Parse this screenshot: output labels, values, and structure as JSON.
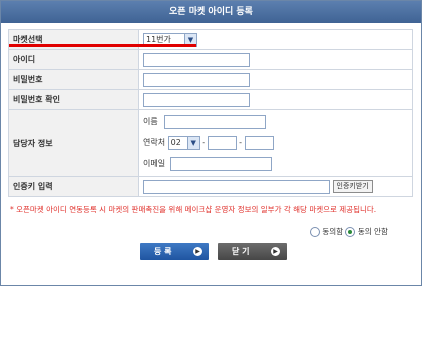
{
  "title": "오픈 마켓 아이디 등록",
  "rows": {
    "market": {
      "label": "마켓선택",
      "selected": "11번가"
    },
    "id": {
      "label": "아이디"
    },
    "password": {
      "label": "비밀번호"
    },
    "password_confirm": {
      "label": "비밀번호 확인"
    },
    "manager": {
      "label": "담당자 정보",
      "name_label": "이름",
      "phone_label": "연락처",
      "phone_prefix": "02",
      "phone_sep1": "-",
      "phone_sep2": "-",
      "email_label": "이메일"
    },
    "auth_key": {
      "label": "인증키 입력",
      "button": "인증키받기"
    }
  },
  "notice": "* 오픈마켓 아이디 연동등록 시 마켓의 판매촉진을 위해 메이크샵 운영자 정보의 일부가 각 해당 마켓으로 제공됩니다.",
  "consent": {
    "agree": "동의함",
    "disagree": "동의 안함",
    "selected": "disagree"
  },
  "buttons": {
    "register": "등 록",
    "close": "닫 기"
  },
  "colors": {
    "title_bar": "#4a6ea0",
    "highlight": "#e00000",
    "register_button": "#2a63b2",
    "close_button": "#5a5a5a",
    "notice_text": "#e0302b"
  }
}
